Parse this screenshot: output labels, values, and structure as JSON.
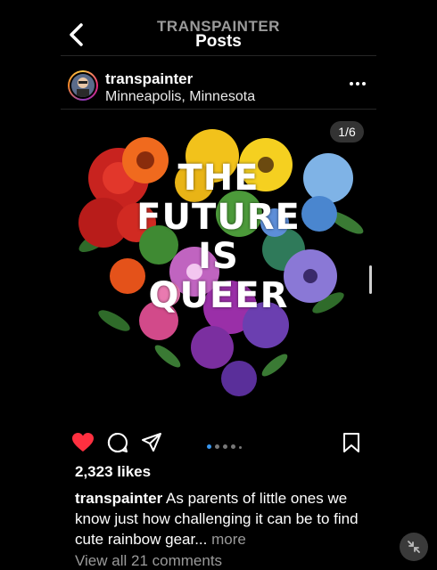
{
  "header": {
    "app_name": "TRANSPAINTER",
    "title": "Posts"
  },
  "post": {
    "username": "transpainter",
    "location": "Minneapolis, Minnesota",
    "image_counter": "1/6",
    "image_text_lines": [
      "THE",
      "FUTURE",
      "IS",
      "QUEER"
    ],
    "likes": "2,323 likes",
    "caption_user": "transpainter",
    "caption_text": " As parents of little ones we know just how challenging it can be to find cute rainbow gear...",
    "caption_more": " more",
    "comments_link": "View all 21 comments",
    "carousel": {
      "total": 6,
      "active": 1
    }
  },
  "icons": {
    "back": "chevron-left-icon",
    "more": "more-horizontal-icon",
    "like": "heart-filled-icon",
    "comment": "comment-icon",
    "share": "send-icon",
    "save": "bookmark-icon",
    "fab": "exit-fullscreen-icon"
  },
  "colors": {
    "background": "#000000",
    "like_red": "#ff3040",
    "carousel_active": "#3897f0",
    "muted": "#9a9a9a"
  }
}
